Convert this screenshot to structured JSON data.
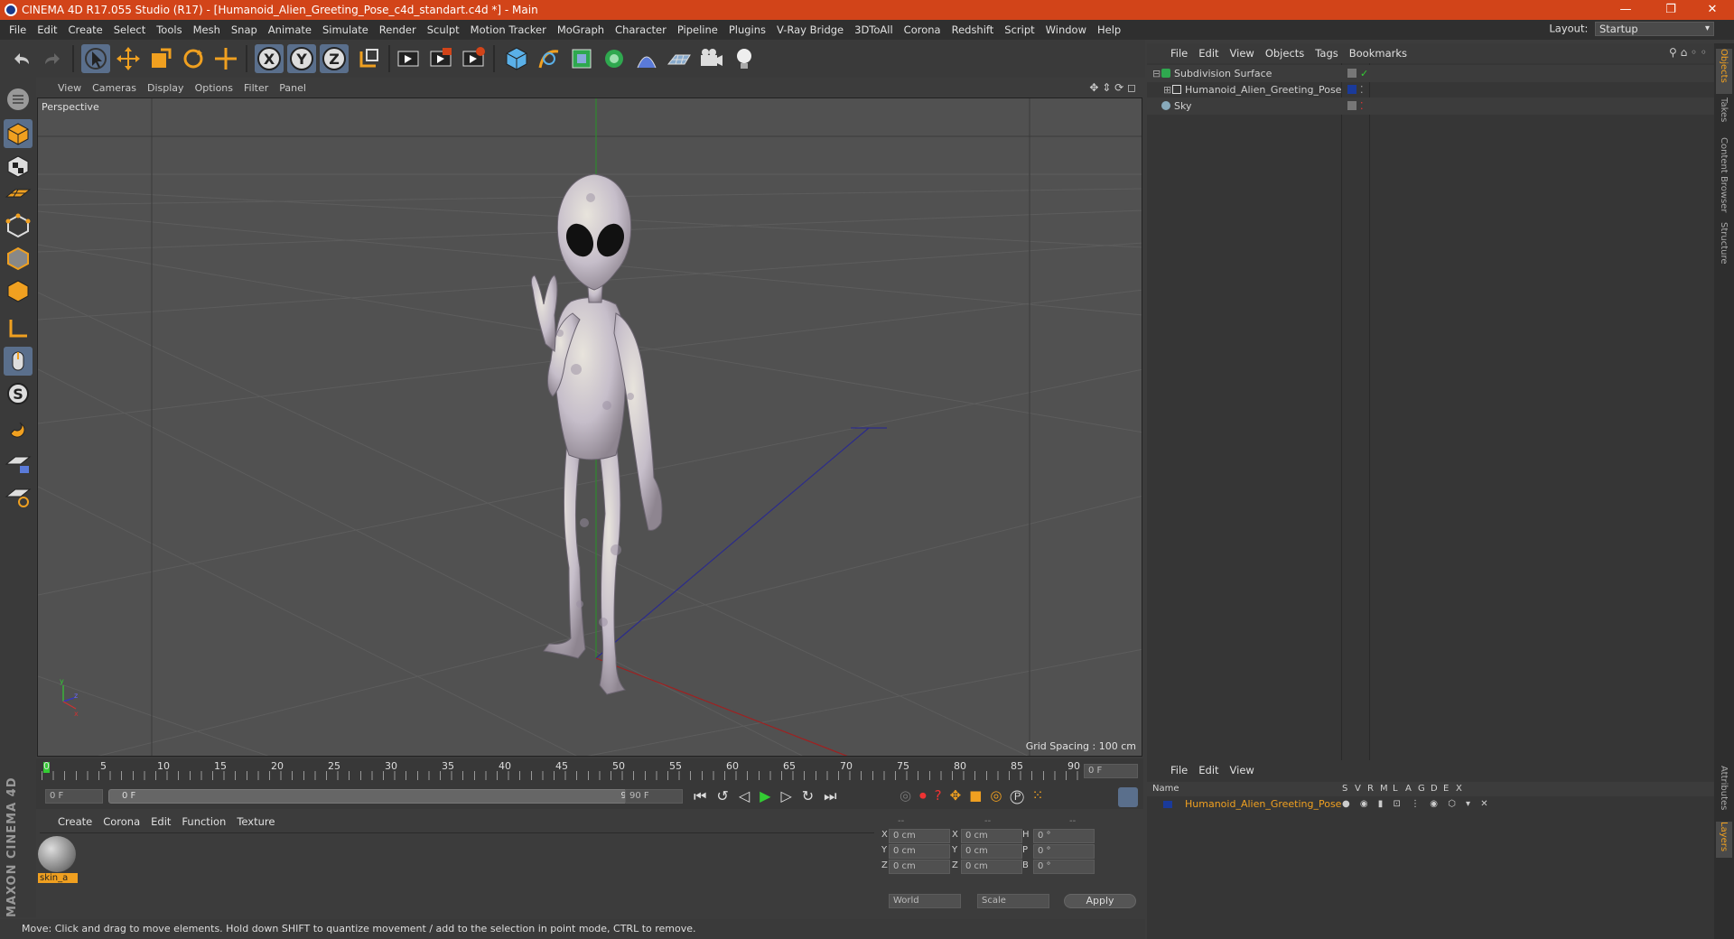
{
  "window": {
    "title": "CINEMA 4D R17.055 Studio (R17) - [Humanoid_Alien_Greeting_Pose_c4d_standart.c4d *] - Main"
  },
  "menu": [
    "File",
    "Edit",
    "Create",
    "Select",
    "Tools",
    "Mesh",
    "Snap",
    "Animate",
    "Simulate",
    "Render",
    "Sculpt",
    "Motion Tracker",
    "MoGraph",
    "Character",
    "Pipeline",
    "Plugins",
    "V-Ray Bridge",
    "3DToAll",
    "Corona",
    "Redshift",
    "Script",
    "Window",
    "Help"
  ],
  "layout": {
    "label": "Layout:",
    "value": "Startup"
  },
  "viewport": {
    "menu": [
      "View",
      "Cameras",
      "Display",
      "Options",
      "Filter",
      "Panel"
    ],
    "label": "Perspective",
    "grid_spacing": "Grid Spacing : 100 cm"
  },
  "objects": {
    "menu": [
      "File",
      "Edit",
      "View",
      "Objects",
      "Tags",
      "Bookmarks"
    ],
    "items": [
      "Subdivision Surface",
      "Humanoid_Alien_Greeting_Pose",
      "Sky"
    ]
  },
  "layers": {
    "menu": [
      "File",
      "Edit",
      "View"
    ],
    "header": {
      "name": "Name",
      "cols": [
        "S",
        "V",
        "R",
        "M",
        "L",
        "A",
        "G",
        "D",
        "E",
        "X"
      ]
    },
    "row": "Humanoid_Alien_Greeting_Pose"
  },
  "timeline": {
    "ticks": [
      "0",
      "5",
      "10",
      "15",
      "20",
      "25",
      "30",
      "35",
      "40",
      "45",
      "50",
      "55",
      "60",
      "65",
      "70",
      "75",
      "80",
      "85",
      "90"
    ],
    "current_frame": "0 F",
    "start": "0 F",
    "range_start": "0 F",
    "range_end": "90 F",
    "end": "90 F"
  },
  "material": {
    "menu": [
      "Create",
      "Corona",
      "Edit",
      "Function",
      "Texture"
    ],
    "name": "skin_a"
  },
  "coordinates": {
    "headers": [
      "--",
      "--",
      "--"
    ],
    "rows": [
      {
        "a": "X",
        "av": "0 cm",
        "b": "X",
        "bv": "0 cm",
        "c": "H",
        "cv": "0 °"
      },
      {
        "a": "Y",
        "av": "0 cm",
        "b": "Y",
        "bv": "0 cm",
        "c": "P",
        "cv": "0 °"
      },
      {
        "a": "Z",
        "av": "0 cm",
        "b": "Z",
        "bv": "0 cm",
        "c": "B",
        "cv": "0 °"
      }
    ],
    "mode": "World",
    "scale": "Scale",
    "apply": "Apply"
  },
  "status": "Move: Click and drag to move elements. Hold down SHIFT to quantize movement / add to the selection in point mode, CTRL to remove.",
  "right_tabs": [
    "Objects",
    "Takes",
    "Content Browser",
    "Structure"
  ],
  "right_tabs_bottom": [
    "Attributes",
    "Layers"
  ],
  "brand": "MAXON CINEMA 4D",
  "colors": {
    "title_bar": "#d24419",
    "accent": "#f0a020",
    "select": "#5a6f8c"
  }
}
